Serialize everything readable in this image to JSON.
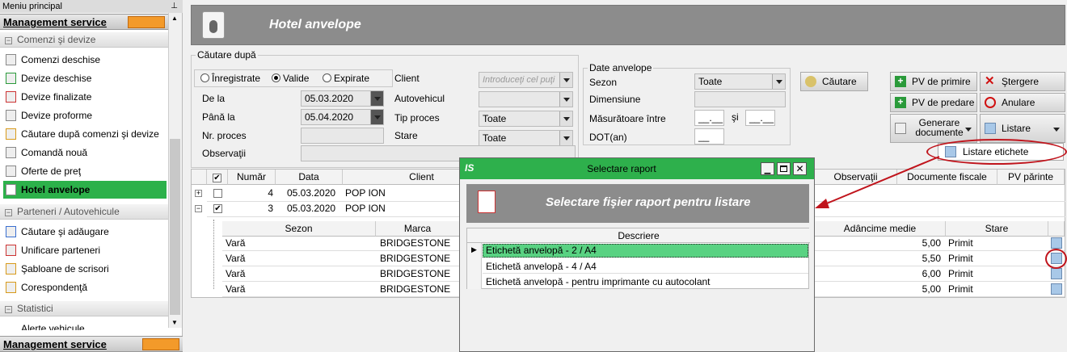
{
  "sidebar": {
    "header": "Meniu principal",
    "banner": "Management service",
    "sections": {
      "orders": "Comenzi şi devize",
      "partners": "Parteneri / Autovehicule",
      "stats": "Statistici"
    },
    "orders_items": [
      "Comenzi deschise",
      "Devize deschise",
      "Devize finalizate",
      "Devize proforme",
      "Căutare după comenzi şi devize",
      "Comandă nouă",
      "Oferte de preţ",
      "Hotel anvelope"
    ],
    "partner_items": [
      "Căutare şi adăugare",
      "Unificare parteneri",
      "Şabloane de scrisori",
      "Corespondenţă"
    ],
    "cutoff_item": "Alerte vehicule",
    "bottom_banner": "Management service"
  },
  "page": {
    "title": "Hotel anvelope"
  },
  "search": {
    "legend": "Căutare după",
    "radio_options": [
      "Înregistrate",
      "Valide",
      "Expirate"
    ],
    "radio_selected": "Valide",
    "from_label": "De la",
    "from_value": "05.03.2020",
    "to_label": "Până la",
    "to_value": "05.04.2020",
    "proc_label": "Nr. proces",
    "obs_label": "Observaţii",
    "client_label": "Client",
    "client_placeholder": "Introduceţi cel puţi",
    "vehicle_label": "Autovehicul",
    "proc_type_label": "Tip proces",
    "proc_type_value": "Toate",
    "state_label": "Stare",
    "state_value": "Toate"
  },
  "tires": {
    "legend": "Date anvelope",
    "season_label": "Sezon",
    "season_value": "Toate",
    "dim_label": "Dimensiune",
    "measure_label": "Măsurătoare între",
    "and_label": "şi",
    "range_from": "__.__",
    "range_to": "__.__",
    "dot_label": "DOT(an)",
    "dot_value": "__"
  },
  "buttons": {
    "search": "Căutare",
    "pv_receive": "PV de primire",
    "pv_deliver": "PV de predare",
    "gen_docs_1": "Generare",
    "gen_docs_2": "documente",
    "delete": "Ştergere",
    "cancel": "Anulare",
    "list": "Listare",
    "list_labels": "Listare etichete"
  },
  "grid": {
    "columns": [
      "Număr",
      "Data",
      "Client",
      "Observaţii",
      "Documente fiscale",
      "PV părinte"
    ],
    "rows": [
      {
        "number": "4",
        "date": "05.03.2020",
        "client": "POP ION",
        "expander": "+"
      },
      {
        "number": "3",
        "date": "05.03.2020",
        "client": "POP ION",
        "expander": "−",
        "checked": "✔"
      }
    ],
    "sub_columns": [
      "Sezon",
      "Marca",
      "Adâncime medie",
      "Stare"
    ],
    "sub_rows": [
      {
        "season": "Vară",
        "brand": "BRIDGESTONE",
        "depth": "5,00",
        "state": "Primit"
      },
      {
        "season": "Vară",
        "brand": "BRIDGESTONE",
        "depth": "5,50",
        "state": "Primit"
      },
      {
        "season": "Vară",
        "brand": "BRIDGESTONE",
        "depth": "6,00",
        "state": "Primit"
      },
      {
        "season": "Vară",
        "brand": "BRIDGESTONE",
        "depth": "5,00",
        "state": "Primit"
      }
    ]
  },
  "dialog": {
    "title": "Selectare raport",
    "heading": "Selectare fişier raport pentru listare",
    "column": "Descriere",
    "items": [
      "Etichetă anvelopă - 2 / A4",
      "Etichetă anvelopă - 4 / A4",
      "Etichetă anvelopă - pentru imprimante cu autocolant"
    ],
    "selected_index": 0
  },
  "colors": {
    "accent_green": "#2eb04c",
    "annotation_red": "#c0141c",
    "title_gray": "#8c8c8c"
  }
}
